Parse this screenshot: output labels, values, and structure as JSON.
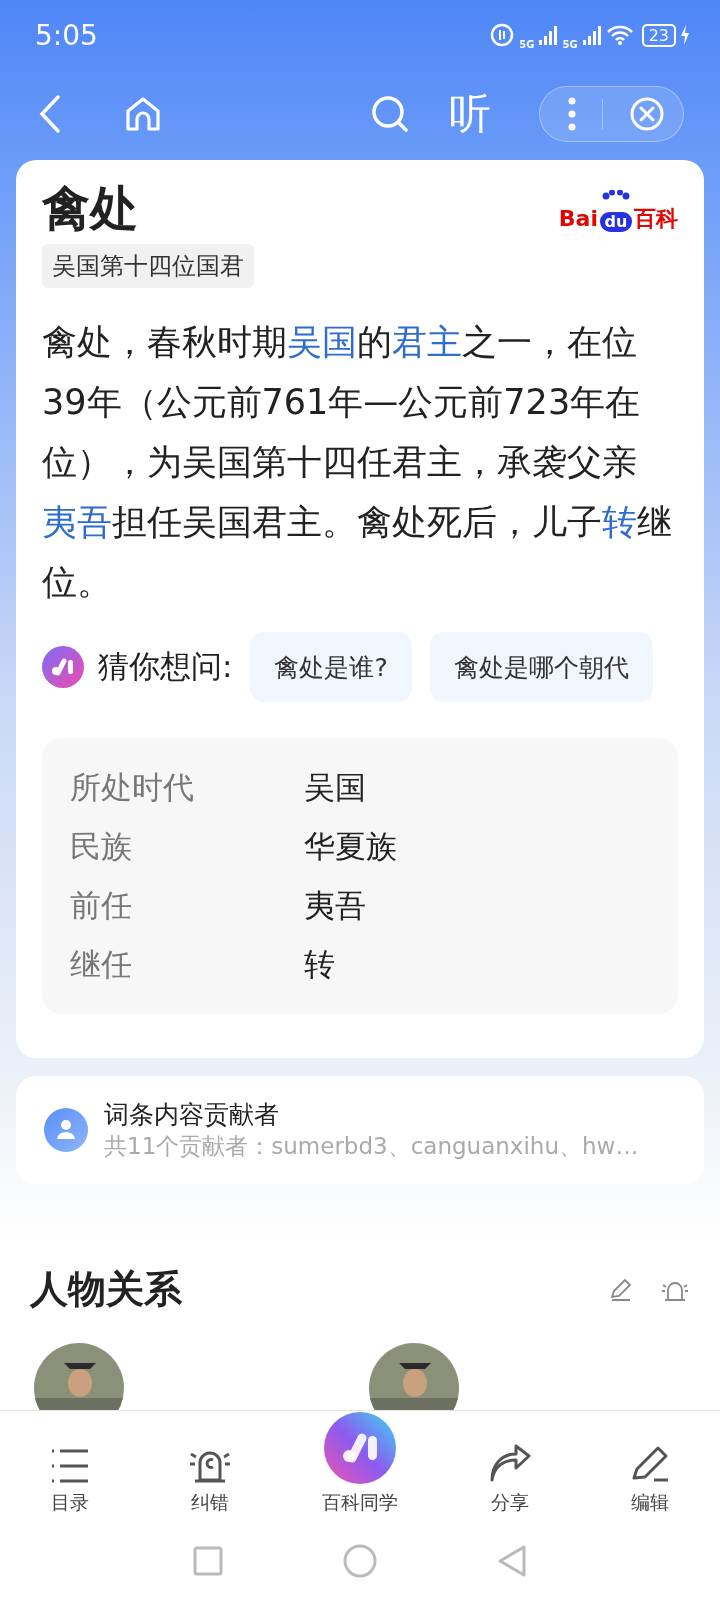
{
  "status_bar": {
    "time": "5:05",
    "network_labels": [
      "5G",
      "5G"
    ],
    "battery": "23"
  },
  "nav": {
    "listen_label": "听"
  },
  "entry": {
    "title": "禽处",
    "tag": "吴国第十四位国君",
    "logo": [
      "Bai",
      "du",
      "百科"
    ],
    "summary": [
      {
        "text": "禽处，春秋时期",
        "link": false
      },
      {
        "text": "吴国",
        "link": true
      },
      {
        "text": "的",
        "link": false
      },
      {
        "text": "君主",
        "link": true
      },
      {
        "text": "之一，在位39年（公元前761年—公元前723年在位），为吴国第十四任君主，承袭父亲",
        "link": false
      },
      {
        "text": "夷吾",
        "link": true
      },
      {
        "text": "担任吴国君主。禽处死后，儿子",
        "link": false
      },
      {
        "text": "转",
        "link": true
      },
      {
        "text": "继位。",
        "link": false
      }
    ],
    "guess": {
      "label": "猜你想问:",
      "chips": [
        "禽处是谁?",
        "禽处是哪个朝代"
      ]
    },
    "facts": [
      {
        "label": "所处时代",
        "value": "吴国"
      },
      {
        "label": "民族",
        "value": "华夏族"
      },
      {
        "label": "前任",
        "value": "夷吾"
      },
      {
        "label": "继任",
        "value": "转"
      }
    ]
  },
  "contributors": {
    "title": "词条内容贡献者",
    "line": "共11个贡献者：sumerbd3、canguanxihu、hw…"
  },
  "relations": {
    "title": "人物关系"
  },
  "bottom_bar": [
    {
      "kind": "list",
      "label": "目录"
    },
    {
      "kind": "alarm",
      "label": "纠错"
    },
    {
      "kind": "ai",
      "label": "百科同学"
    },
    {
      "kind": "share",
      "label": "分享"
    },
    {
      "kind": "edit",
      "label": "编辑"
    }
  ]
}
